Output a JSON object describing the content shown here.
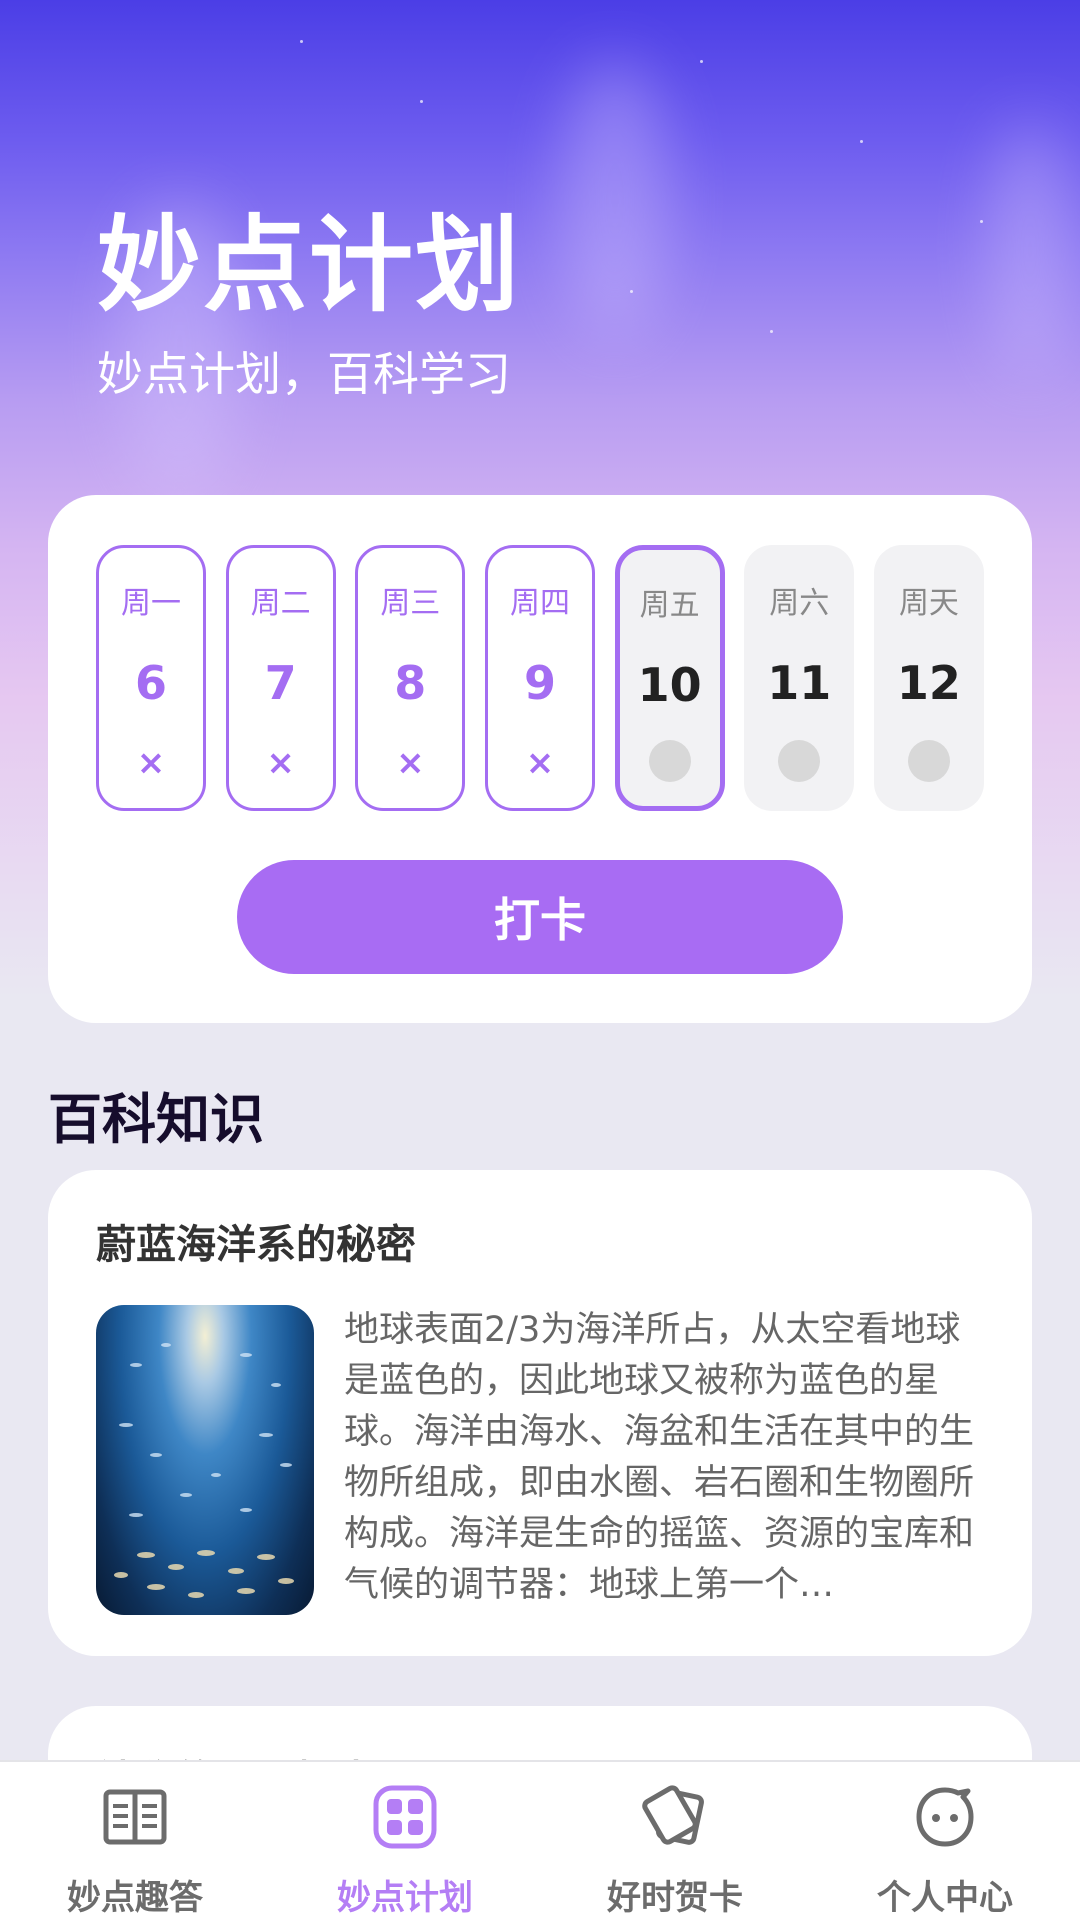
{
  "hero": {
    "title": "妙点计划",
    "subtitle": "妙点计划，百科学习"
  },
  "checkin": {
    "days": [
      {
        "weekday": "周一",
        "date": "6",
        "status": "missed"
      },
      {
        "weekday": "周二",
        "date": "7",
        "status": "missed"
      },
      {
        "weekday": "周三",
        "date": "8",
        "status": "missed"
      },
      {
        "weekday": "周四",
        "date": "9",
        "status": "missed"
      },
      {
        "weekday": "周五",
        "date": "10",
        "status": "today"
      },
      {
        "weekday": "周六",
        "date": "11",
        "status": "upcoming"
      },
      {
        "weekday": "周天",
        "date": "12",
        "status": "upcoming"
      }
    ],
    "missed_mark": "×",
    "button_label": "打卡"
  },
  "knowledge": {
    "section_title": "百科知识",
    "articles": [
      {
        "title": "蔚蓝海洋系的秘密",
        "text": "地球表面2/3为海洋所占，从太空看地球是蓝色的，因此地球又被称为蓝色的星球。海洋由海水、海盆和生活在其中的生物所组成，即由水圈、岩石圈和生物圈所构成。海洋是生命的摇篮、资源的宝库和气候的调节器：地球上第一个…",
        "image": "ocean-fish-image"
      },
      {
        "title": "神秘的黑洞探索"
      }
    ]
  },
  "tabbar": {
    "tabs": [
      {
        "label": "妙点趣答",
        "icon": "book-icon",
        "active": false
      },
      {
        "label": "妙点计划",
        "icon": "grid-icon",
        "active": true
      },
      {
        "label": "好时贺卡",
        "icon": "cards-icon",
        "active": false
      },
      {
        "label": "个人中心",
        "icon": "face-icon",
        "active": false
      }
    ]
  },
  "colors": {
    "accent": "#a86cf3",
    "active_tab": "#b47ef5",
    "inactive_tab": "#6c6c6c"
  }
}
